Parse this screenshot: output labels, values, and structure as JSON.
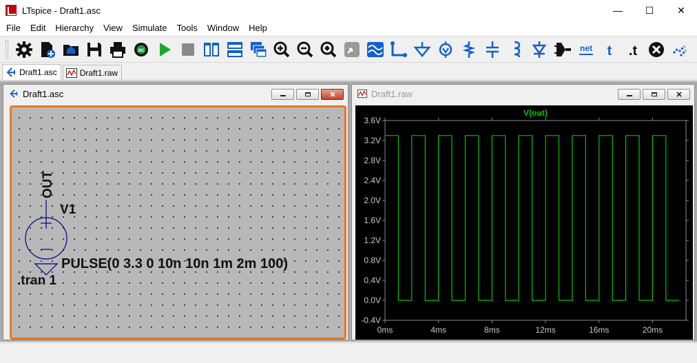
{
  "window": {
    "title": "LTspice - Draft1.asc",
    "controls": {
      "minimize": "—",
      "maximize": "☐",
      "close": "✕"
    }
  },
  "menu": [
    "File",
    "Edit",
    "Hierarchy",
    "View",
    "Simulate",
    "Tools",
    "Window",
    "Help"
  ],
  "toolbar": {
    "buttons": [
      "settings-icon",
      "new-schematic-icon",
      "open-icon",
      "save-icon",
      "print-icon",
      "control-panel-icon",
      "run-icon",
      "halt-icon",
      "tile-vertical-icon",
      "tile-horizontal-icon",
      "cascade-icon",
      "zoom-in-icon",
      "zoom-out-icon",
      "zoom-fit-icon",
      "autoscale-icon",
      "waveform-icon",
      "wire-icon",
      "ground-icon",
      "voltage-source-icon",
      "resistor-icon",
      "capacitor-icon",
      "inductor-icon",
      "diode-icon",
      "component-icon",
      "label-net-icon",
      "text-icon",
      "spice-directive-icon",
      "delete-icon",
      "more-icon"
    ],
    "net_label": "net",
    "text_label": "t",
    "directive_label": ".t"
  },
  "tabs": [
    {
      "label": "Draft1.asc",
      "active": true
    },
    {
      "label": "Draft1.raw",
      "active": false
    }
  ],
  "schematic_window": {
    "title": "Draft1.asc",
    "net_label": "OUT",
    "component_name": "V1",
    "component_value": "PULSE(0 3.3 0 10n 10n 1m 2m 100)",
    "directive": ".tran 1"
  },
  "waveform_window": {
    "title": "Draft1.raw",
    "trace_name": "V(out)",
    "trace_color": "#00c800",
    "frame_color": "#8a8a8a"
  },
  "colors": {
    "accent_border": "#e87722",
    "schematic_background": "#b8b8b8",
    "plot_background": "#000000",
    "toolbar_icon_blue": "#1060d0"
  },
  "chart_data": {
    "type": "line",
    "title": "V(out)",
    "xlabel": "",
    "ylabel": "",
    "x_unit": "ms",
    "y_unit": "V",
    "xlim": [
      0,
      22.5
    ],
    "ylim": [
      -0.4,
      3.6
    ],
    "x_ticks": [
      "0ms",
      "4ms",
      "8ms",
      "12ms",
      "16ms",
      "20ms"
    ],
    "x_tick_values": [
      0,
      4,
      8,
      12,
      16,
      20
    ],
    "y_ticks": [
      "3.6V",
      "3.2V",
      "2.8V",
      "2.4V",
      "2.0V",
      "1.6V",
      "1.2V",
      "0.8V",
      "0.4V",
      "0.0V",
      "-0.4V"
    ],
    "y_tick_values": [
      3.6,
      3.2,
      2.8,
      2.4,
      2.0,
      1.6,
      1.2,
      0.8,
      0.4,
      0.0,
      -0.4
    ],
    "series": [
      {
        "name": "V(out)",
        "description": "square wave: 3.3V high for 1ms, 0V low for 1ms, period 2ms",
        "x": [
          0,
          1,
          1,
          2,
          2,
          3,
          3,
          4,
          4,
          5,
          5,
          6,
          6,
          7,
          7,
          8,
          8,
          9,
          9,
          10,
          10,
          11,
          11,
          12,
          12,
          13,
          13,
          14,
          14,
          15,
          15,
          16,
          16,
          17,
          17,
          18,
          18,
          19,
          19,
          20,
          20,
          21,
          21,
          22
        ],
        "y": [
          3.3,
          3.3,
          0,
          0,
          3.3,
          3.3,
          0,
          0,
          3.3,
          3.3,
          0,
          0,
          3.3,
          3.3,
          0,
          0,
          3.3,
          3.3,
          0,
          0,
          3.3,
          3.3,
          0,
          0,
          3.3,
          3.3,
          0,
          0,
          3.3,
          3.3,
          0,
          0,
          3.3,
          3.3,
          0,
          0,
          3.3,
          3.3,
          0,
          0,
          3.3,
          3.3,
          0,
          0
        ]
      }
    ],
    "grid": false,
    "legend": "top-center"
  }
}
